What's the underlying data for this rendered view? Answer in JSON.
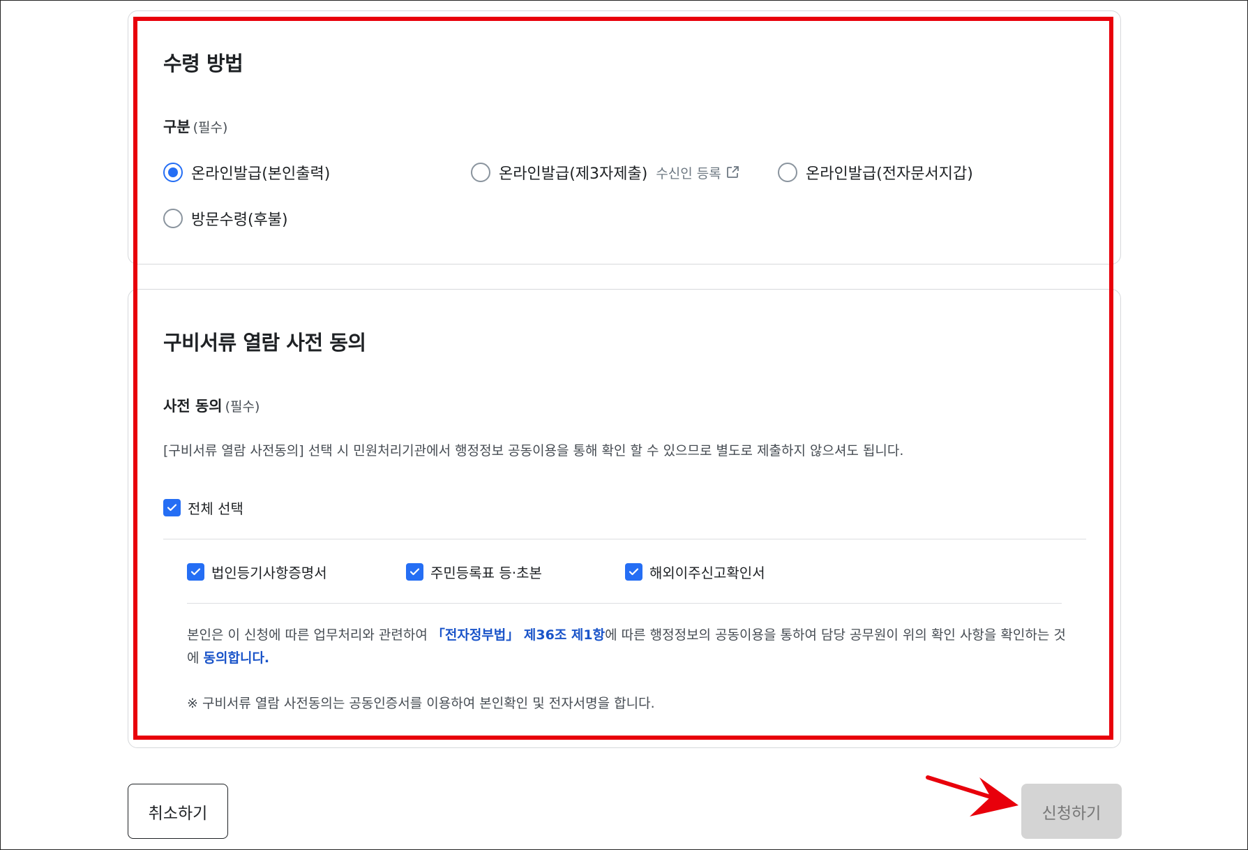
{
  "section_receive": {
    "title": "수령 방법",
    "field_label": "구분",
    "required_text": "(필수)",
    "options": [
      {
        "label": "온라인발급(본인출력)",
        "checked": true
      },
      {
        "label": "온라인발급(제3자제출)",
        "checked": false,
        "sub_label": "수신인 등록"
      },
      {
        "label": "온라인발급(전자문서지갑)",
        "checked": false
      },
      {
        "label": "방문수령(후불)",
        "checked": false
      }
    ]
  },
  "section_consent": {
    "title": "구비서류 열람 사전 동의",
    "field_label": "사전 동의",
    "required_text": "(필수)",
    "description": "[구비서류 열람 사전동의] 선택 시 민원처리기관에서 행정정보 공동이용을 통해 확인 할 수 있으므로 별도로 제출하지 않으셔도 됩니다.",
    "select_all_label": "전체 선택",
    "items": [
      {
        "label": "법인등기사항증명서",
        "checked": true
      },
      {
        "label": "주민등록표 등·초본",
        "checked": true
      },
      {
        "label": "해외이주신고확인서",
        "checked": true
      }
    ],
    "agreement": {
      "part1": "본인은 이 신청에 따른 업무처리와 관련하여 ",
      "law": "「전자정부법」 제36조 제1항",
      "part2": "에 따른 행정정보의 공동이용을 통하여 담당 공무원이 위의 확인 사항을 확인하는 것에 ",
      "agree": "동의합니다."
    },
    "note": "※ 구비서류 열람 사전동의는 공동인증서를 이용하여 본인확인 및 전자서명을 합니다."
  },
  "buttons": {
    "cancel": "취소하기",
    "submit": "신청하기"
  },
  "colors": {
    "accent": "#256ef4",
    "highlight_text": "#1a54c9",
    "annotation_red": "#e8000b",
    "submit_disabled_bg": "#d4d4d4"
  }
}
